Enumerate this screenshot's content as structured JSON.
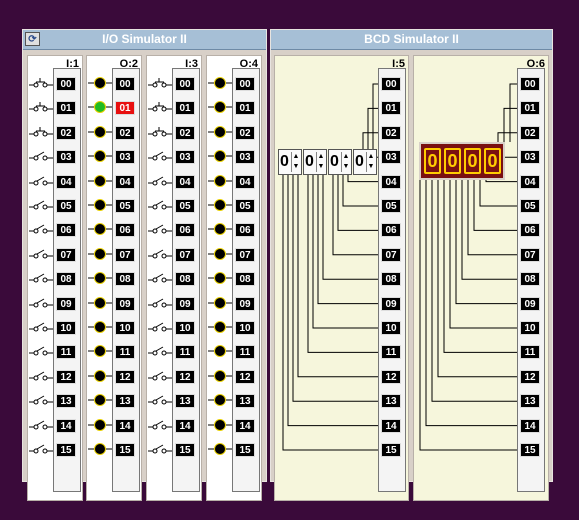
{
  "io_window": {
    "title": "I/O Simulator II",
    "sysmenu_icon": "restore-icon",
    "panels": [
      {
        "label": "I:1",
        "type": "input-switch"
      },
      {
        "label": "O:2",
        "type": "output-led"
      },
      {
        "label": "I:3",
        "type": "input-switch"
      },
      {
        "label": "O:4",
        "type": "output-led"
      }
    ],
    "bits": [
      "00",
      "01",
      "02",
      "03",
      "04",
      "05",
      "06",
      "07",
      "08",
      "09",
      "10",
      "11",
      "12",
      "13",
      "14",
      "15"
    ],
    "o2_active_bit": "01",
    "colors": {
      "led_off": "#000000",
      "led_on": "#22bb22",
      "bit_on": "#e81010"
    }
  },
  "bcd_window": {
    "title": "BCD Simulator II",
    "panels": [
      {
        "label": "I:5",
        "type": "thumbwheel",
        "digits": [
          "0",
          "0",
          "0",
          "0"
        ]
      },
      {
        "label": "O:6",
        "type": "led-display",
        "digits": [
          "0",
          "0",
          "0",
          "0"
        ]
      }
    ],
    "bits": [
      "00",
      "01",
      "02",
      "03",
      "04",
      "05",
      "06",
      "07",
      "08",
      "09",
      "10",
      "11",
      "12",
      "13",
      "14",
      "15"
    ],
    "colors": {
      "display_bg": "#7a1010",
      "display_fg": "#ffcc00"
    }
  }
}
